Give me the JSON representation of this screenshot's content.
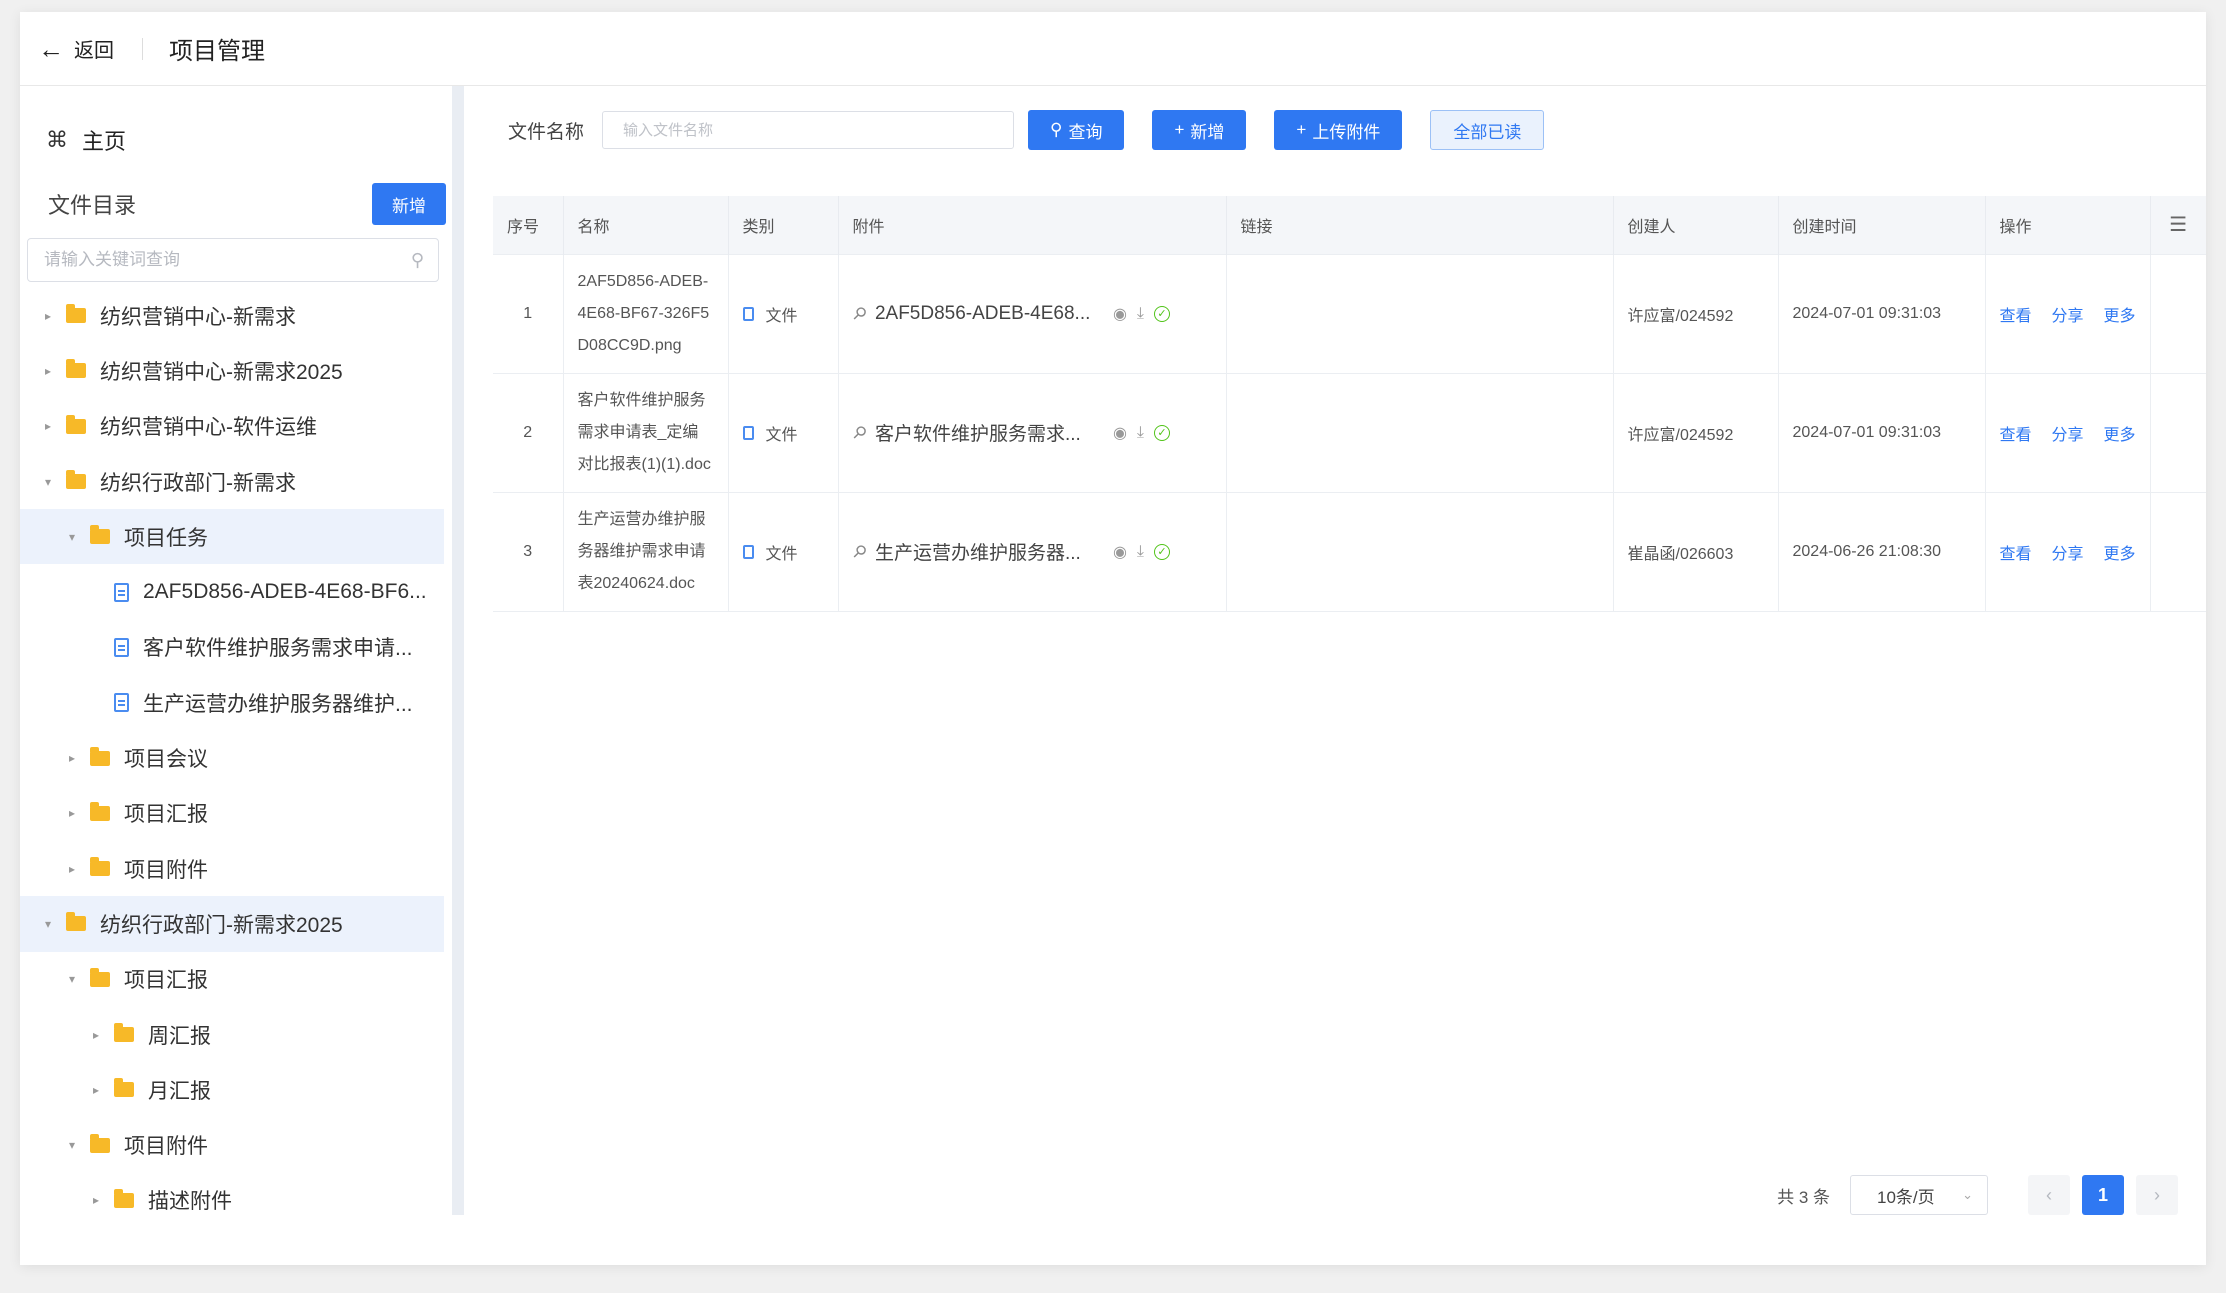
{
  "header": {
    "back_label": "返回",
    "title": "项目管理"
  },
  "sidebar": {
    "home_label": "主页",
    "directory_title": "文件目录",
    "add_button": "新增",
    "search_placeholder": "请输入关键词查询",
    "tree": [
      {
        "label": "纺织营销中心-新需求",
        "type": "folder",
        "depth": 0,
        "expanded": false
      },
      {
        "label": "纺织营销中心-新需求2025",
        "type": "folder",
        "depth": 0,
        "expanded": false
      },
      {
        "label": "纺织营销中心-软件运维",
        "type": "folder",
        "depth": 0,
        "expanded": false
      },
      {
        "label": "纺织行政部门-新需求",
        "type": "folder",
        "depth": 0,
        "expanded": true
      },
      {
        "label": "项目任务",
        "type": "folder",
        "depth": 1,
        "expanded": true,
        "selected": true
      },
      {
        "label": "2AF5D856-ADEB-4E68-BF6...",
        "type": "file",
        "depth": 2
      },
      {
        "label": "客户软件维护服务需求申请...",
        "type": "file",
        "depth": 2
      },
      {
        "label": "生产运营办维护服务器维护...",
        "type": "file",
        "depth": 2
      },
      {
        "label": "项目会议",
        "type": "folder",
        "depth": 1,
        "expanded": false
      },
      {
        "label": "项目汇报",
        "type": "folder",
        "depth": 1,
        "expanded": false
      },
      {
        "label": "项目附件",
        "type": "folder",
        "depth": 1,
        "expanded": false
      },
      {
        "label": "纺织行政部门-新需求2025",
        "type": "folder",
        "depth": 0,
        "expanded": true,
        "selected": true
      },
      {
        "label": "项目汇报",
        "type": "folder",
        "depth": 1,
        "expanded": true
      },
      {
        "label": "周汇报",
        "type": "folder",
        "depth": 2,
        "expanded": false
      },
      {
        "label": "月汇报",
        "type": "folder",
        "depth": 2,
        "expanded": false
      },
      {
        "label": "项目附件",
        "type": "folder",
        "depth": 1,
        "expanded": true
      },
      {
        "label": "描述附件",
        "type": "folder",
        "depth": 2,
        "expanded": false
      }
    ]
  },
  "filter": {
    "label": "文件名称",
    "placeholder": "输入文件名称",
    "query_button": "查询",
    "add_button": "新增",
    "upload_button": "上传附件",
    "mark_all_read_button": "全部已读"
  },
  "table": {
    "columns": [
      "序号",
      "名称",
      "类别",
      "附件",
      "链接",
      "创建人",
      "创建时间",
      "操作"
    ],
    "rows": [
      {
        "no": "1",
        "name": "2AF5D856-ADEB-4E68-BF67-326F5D08CC9D.png",
        "type": "文件",
        "attachment": "2AF5D856-ADEB-4E68...",
        "link": "",
        "creator": "许应富/024592",
        "created_at": "2024-07-01 09:31:03"
      },
      {
        "no": "2",
        "name": "客户软件维护服务需求申请表_定编对比报表(1)(1).doc",
        "type": "文件",
        "attachment": "客户软件维护服务需求...",
        "link": "",
        "creator": "许应富/024592",
        "created_at": "2024-07-01 09:31:03"
      },
      {
        "no": "3",
        "name": "生产运营办维护服务器维护需求申请表20240624.doc",
        "type": "文件",
        "attachment": "生产运营办维护服务器...",
        "link": "",
        "creator": "崔晶函/026603",
        "created_at": "2024-06-26 21:08:30"
      }
    ],
    "actions": [
      "查看",
      "分享",
      "更多"
    ]
  },
  "pagination": {
    "total_text": "共 3 条",
    "page_size": "10条/页",
    "current_page": "1"
  },
  "colors": {
    "primary": "#2f78f2",
    "folder": "#f7b928",
    "success": "#52c41a"
  }
}
